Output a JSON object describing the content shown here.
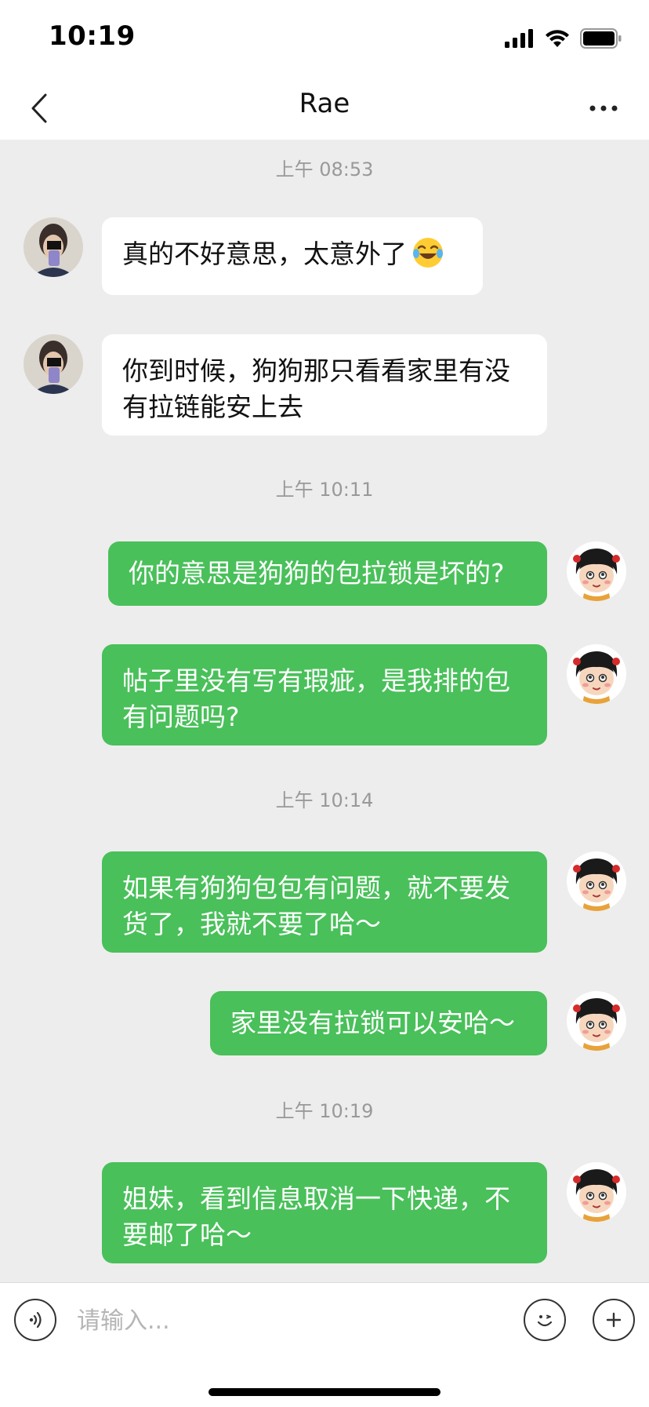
{
  "status_bar": {
    "time": "10:19",
    "signal_icon": "cellular-signal-icon",
    "wifi_icon": "wifi-icon",
    "battery_icon": "battery-icon"
  },
  "nav": {
    "title": "Rae",
    "back_icon": "chevron-left-icon",
    "more_icon": "more-dots-icon"
  },
  "chat": {
    "timestamps": [
      "上午 08:53",
      "上午 10:11",
      "上午 10:14",
      "上午 10:19"
    ],
    "messages": [
      {
        "side": "in",
        "text": "真的不好意思，太意外了",
        "emoji": "laughing-crying-emoji"
      },
      {
        "side": "in",
        "text": "你到时候，狗狗那只看看家里有没有拉链能安上去"
      },
      {
        "side": "out",
        "text": "你的意思是狗狗的包拉锁是坏的?"
      },
      {
        "side": "out",
        "text": "帖子里没有写有瑕疵，是我排的包有问题吗?"
      },
      {
        "side": "out",
        "text": "如果有狗狗包包有问题，就不要发货了，我就不要了哈～"
      },
      {
        "side": "out",
        "text": "家里没有拉锁可以安哈～"
      },
      {
        "side": "out",
        "text": "姐妹，看到信息取消一下快递，不要邮了哈～"
      }
    ],
    "colors": {
      "outgoing_bubble": "#49c05a",
      "incoming_bubble": "#ffffff",
      "background": "#ededed"
    }
  },
  "input_bar": {
    "placeholder": "请输入...",
    "value": "",
    "voice_icon": "voice-icon",
    "emoji_icon": "smiley-icon",
    "plus_icon": "plus-icon"
  }
}
